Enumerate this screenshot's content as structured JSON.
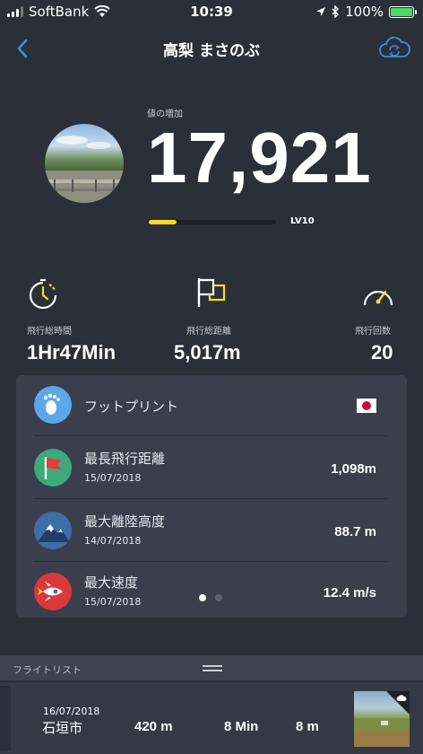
{
  "status_bar": {
    "carrier": "SoftBank",
    "time": "10:39",
    "battery": "100%"
  },
  "header": {
    "title": "高梨 まさのぶ"
  },
  "profile": {
    "score_label": "値の増加",
    "score": "17,921",
    "level": "LV10",
    "level_progress": 0.22
  },
  "stats": {
    "flight_time": {
      "label": "飛行総時間",
      "value": "1Hr47Min",
      "icon": "stopwatch-icon"
    },
    "flight_distance": {
      "label": "飛行総距離",
      "value": "5,017m",
      "icon": "flag-icon"
    },
    "flight_count": {
      "label": "飛行回数",
      "value": "20",
      "icon": "speedometer-icon"
    }
  },
  "records": {
    "footprint": {
      "title": "フットプリント",
      "icon": "footprint-icon",
      "flag": "japan-flag-icon"
    },
    "items": [
      {
        "title": "最長飛行距離",
        "date": "15/07/2018",
        "value": "1,098m",
        "icon": "red-flag-icon"
      },
      {
        "title": "最大離陸高度",
        "date": "14/07/2018",
        "value": "88.7 m",
        "icon": "mountain-icon"
      },
      {
        "title": "最大速度",
        "date": "15/07/2018",
        "value": "12.4 m/s",
        "icon": "rocket-icon"
      }
    ],
    "page_count": 2,
    "current_page": 1
  },
  "flight_list": {
    "header": "フライトリスト",
    "rows": [
      {
        "date": "16/07/2018",
        "place": "石垣市",
        "distance": "420 m",
        "duration": "8 Min",
        "height": "8 m"
      }
    ]
  },
  "colors": {
    "background": "#2b2f38",
    "card": "#3a3f4b",
    "accent_yellow": "#f5d92c",
    "link_blue": "#3b8fe0"
  }
}
